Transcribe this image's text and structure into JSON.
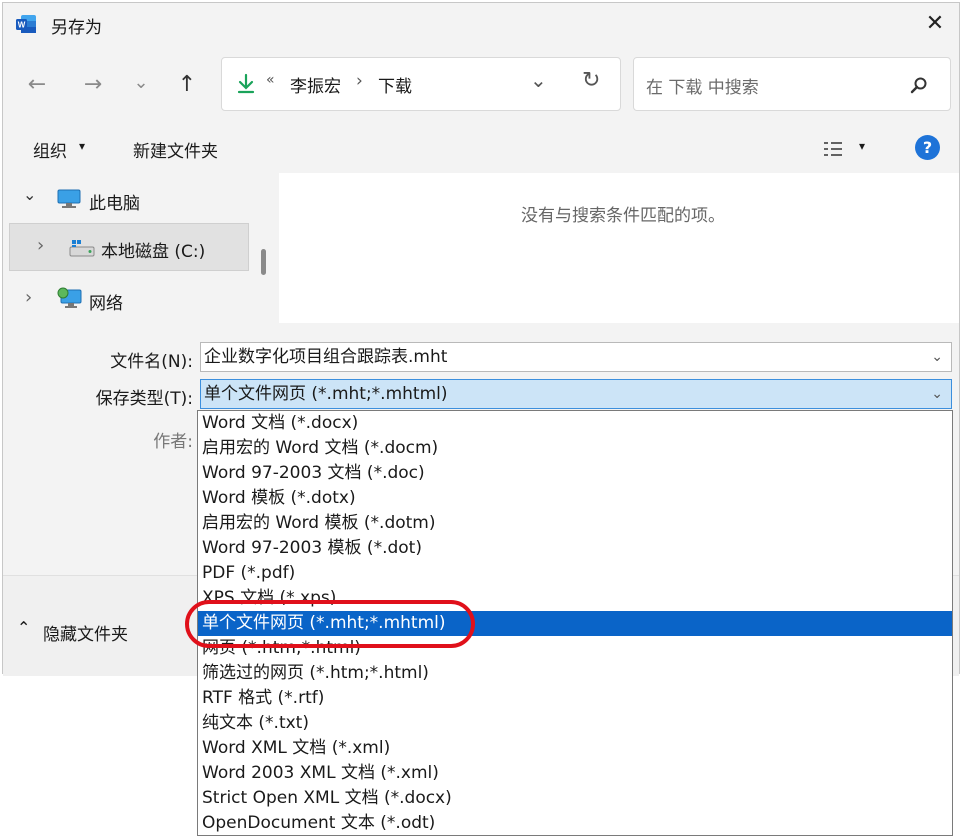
{
  "window": {
    "title": "另存为",
    "close_label": "✕"
  },
  "nav": {
    "back": "←",
    "forward": "→",
    "recent": "⌄",
    "up": "↑",
    "breadcrumb": {
      "overflow": "«",
      "segments": [
        "李振宏",
        "下载"
      ],
      "separator": "›"
    },
    "dropdown": "⌄",
    "refresh": "↻"
  },
  "search": {
    "placeholder": "在 下载 中搜索"
  },
  "toolbar": {
    "organize": "组织",
    "organize_caret": "▾",
    "new_folder": "新建文件夹",
    "view_caret": "▾",
    "help": "?"
  },
  "tree": [
    {
      "label": "此电脑",
      "chevron": "⌄"
    },
    {
      "label": "本地磁盘 (C:)",
      "chevron": "›"
    },
    {
      "label": "网络",
      "chevron": "›"
    }
  ],
  "content": {
    "empty_message": "没有与搜索条件匹配的项。"
  },
  "form": {
    "filename_label": "文件名(N):",
    "filename_value": "企业数字化项目组合跟踪表.mht",
    "type_label": "保存类型(T):",
    "type_value": "单个文件网页 (*.mht;*.mhtml)",
    "author_label": "作者:"
  },
  "footer": {
    "hide_folders": "隐藏文件夹",
    "hide_caret": "⌃"
  },
  "type_options": [
    "Word 文档 (*.docx)",
    "启用宏的 Word 文档 (*.docm)",
    "Word 97-2003 文档 (*.doc)",
    "Word 模板 (*.dotx)",
    "启用宏的 Word 模板 (*.dotm)",
    "Word 97-2003 模板 (*.dot)",
    "PDF (*.pdf)",
    "XPS 文档 (*.xps)",
    "单个文件网页 (*.mht;*.mhtml)",
    "网页 (*.htm;*.html)",
    "筛选过的网页 (*.htm;*.html)",
    "RTF 格式 (*.rtf)",
    "纯文本 (*.txt)",
    "Word XML 文档 (*.xml)",
    "Word 2003 XML 文档 (*.xml)",
    "Strict Open XML 文档 (*.docx)",
    "OpenDocument 文本 (*.odt)"
  ],
  "selected_option_index": 8,
  "colors": {
    "accent": "#0a64c8",
    "highlight_circle": "#e0101a",
    "download_icon": "#1aa35a"
  }
}
